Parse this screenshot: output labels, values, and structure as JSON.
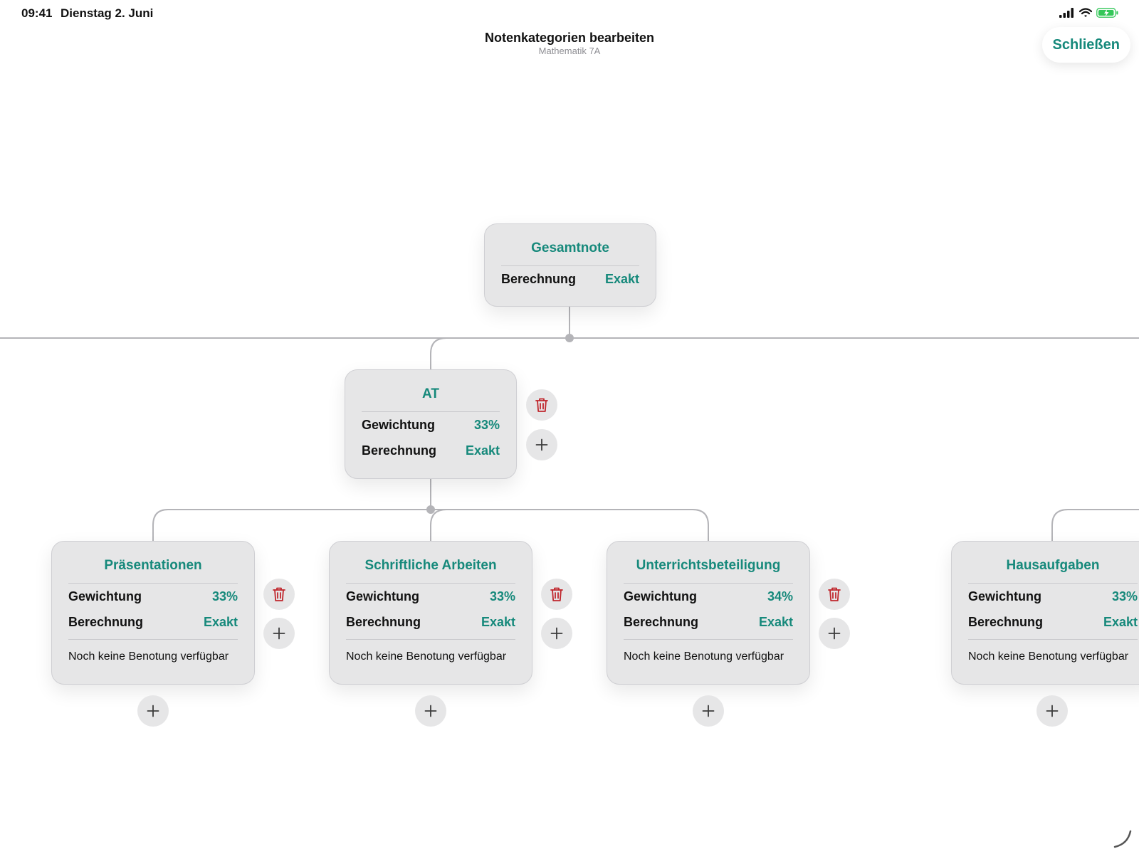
{
  "status_bar": {
    "time": "09:41",
    "date": "Dienstag 2. Juni"
  },
  "header": {
    "title": "Notenkategorien bearbeiten",
    "subtitle": "Mathematik 7A",
    "close_label": "Schließen"
  },
  "colors": {
    "accent": "#16897b",
    "delete": "#c0272d",
    "card": "#e6e6e7",
    "connector": "#b4b4b8"
  },
  "labels": {
    "weight": "Gewichtung",
    "calculation": "Berechnung",
    "empty_grades": "Noch keine Benotung verfügbar"
  },
  "root": {
    "title": "Gesamtnote",
    "calculation": "Exakt"
  },
  "at": {
    "title": "AT",
    "weight": "33%",
    "calculation": "Exakt"
  },
  "children": [
    {
      "title": "Präsentationen",
      "weight": "33%",
      "calculation": "Exakt"
    },
    {
      "title": "Schriftliche Arbeiten",
      "weight": "33%",
      "calculation": "Exakt"
    },
    {
      "title": "Unterrichtsbeteiligung",
      "weight": "34%",
      "calculation": "Exakt"
    },
    {
      "title": "Hausaufgaben",
      "weight": "33%",
      "calculation": "Exakt"
    }
  ],
  "icons": [
    "signal-icon",
    "wifi-icon",
    "battery-charging-icon",
    "trash-icon",
    "plus-icon",
    "resize-corner-icon"
  ]
}
